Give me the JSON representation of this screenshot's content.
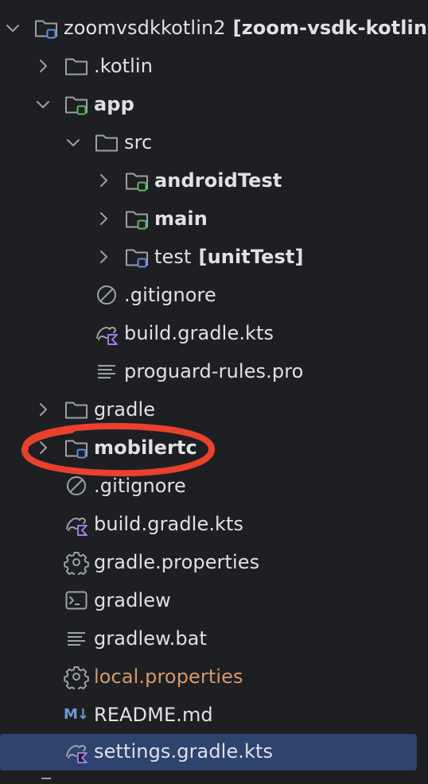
{
  "tree": {
    "root": {
      "name": "zoomvsdkkotlin2",
      "suffix": "[zoom-vsdk-kotlin]"
    },
    "items": {
      "kotlin": ".kotlin",
      "app": "app",
      "src": "src",
      "androidTest": "androidTest",
      "main": "main",
      "test": {
        "name": "test",
        "suffix": "[unitTest]"
      },
      "app_gitignore": ".gitignore",
      "app_build_gradle": "build.gradle.kts",
      "proguard": "proguard-rules.pro",
      "gradle": "gradle",
      "mobilertc": "mobilertc",
      "root_gitignore": ".gitignore",
      "root_build_gradle": "build.gradle.kts",
      "gradle_properties": "gradle.properties",
      "gradlew": "gradlew",
      "gradlew_bat": "gradlew.bat",
      "local_properties": "local.properties",
      "readme": "README.md",
      "settings_gradle": "settings.gradle.kts"
    },
    "readme_icon_text": "M↓"
  },
  "colors": {
    "background": "#1e1f22",
    "text": "#dfe1e5",
    "selection": "#2e436e",
    "icon_gray": "#9da0a8",
    "module_blue": "#5b8fe0",
    "source_green": "#5fb865",
    "kotlin_purple": "#a47ae6",
    "annotation_red": "#e8412c",
    "local_properties": "#d69a6b"
  }
}
